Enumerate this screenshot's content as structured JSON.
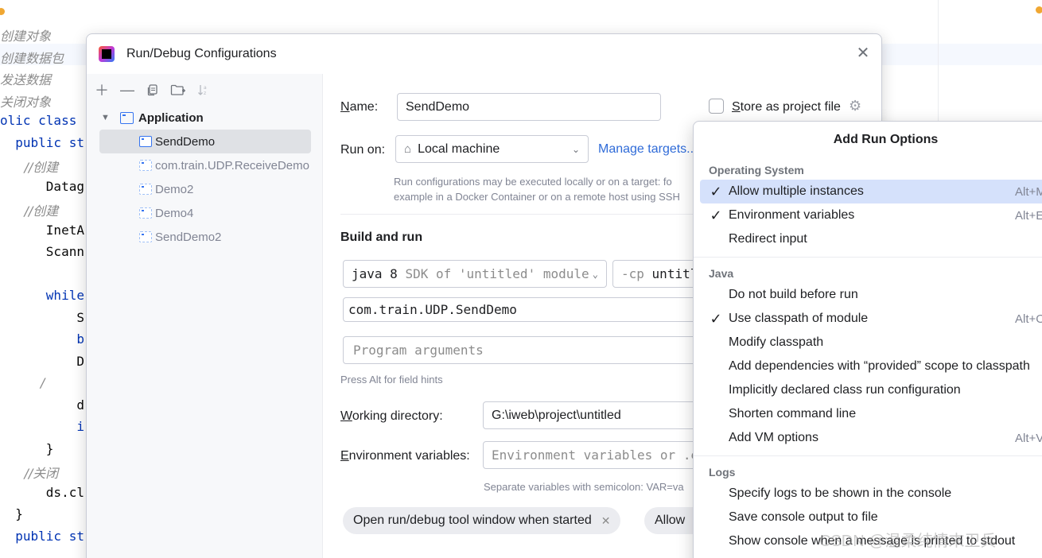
{
  "editor": {
    "lines": [
      {
        "text": "创建对象",
        "kind": "comment"
      },
      {
        "text": "创建数据包",
        "kind": "comment"
      },
      {
        "text": "发送数据",
        "kind": "comment"
      },
      {
        "text": "关闭对象",
        "kind": "comment"
      },
      {
        "text": "olic class",
        "kind": "kw"
      },
      {
        "text": "  public st",
        "kind": "kw"
      },
      {
        "text": "      //创建",
        "kind": "comment"
      },
      {
        "text": "      Datag",
        "kind": "code"
      },
      {
        "text": "      //创建",
        "kind": "comment"
      },
      {
        "text": "      InetA",
        "kind": "code"
      },
      {
        "text": "      Scann",
        "kind": "code"
      },
      {
        "text": "",
        "kind": "code"
      },
      {
        "text": "      while",
        "kind": "kw"
      },
      {
        "text": "          S",
        "kind": "code"
      },
      {
        "text": "          b",
        "kind": "kw"
      },
      {
        "text": "          D",
        "kind": "code"
      },
      {
        "text": "          /",
        "kind": "comment"
      },
      {
        "text": "          d",
        "kind": "code"
      },
      {
        "text": "          i",
        "kind": "kw"
      },
      {
        "text": "      }",
        "kind": "code"
      },
      {
        "text": "      //关闭",
        "kind": "comment"
      },
      {
        "text": "      ds.cl",
        "kind": "code"
      },
      {
        "text": "  }",
        "kind": "code"
      },
      {
        "text": "  public st",
        "kind": "kw"
      }
    ]
  },
  "dialog": {
    "title": "Run/Debug Configurations",
    "close_icon": "close-icon",
    "toolbar": {
      "add_icon": "plus-icon",
      "remove_icon": "minus-icon",
      "copy_icon": "copy-icon",
      "folder_icon": "new-folder-icon",
      "sort_icon": "sort-icon"
    },
    "tree": {
      "group_label": "Application",
      "items": [
        {
          "label": "SendDemo",
          "temporary": false,
          "selected": true
        },
        {
          "label": "com.train.UDP.ReceiveDemo",
          "temporary": true,
          "selected": false
        },
        {
          "label": "Demo2",
          "temporary": true,
          "selected": false
        },
        {
          "label": "Demo4",
          "temporary": true,
          "selected": false
        },
        {
          "label": "SendDemo2",
          "temporary": true,
          "selected": false
        }
      ]
    },
    "form": {
      "name_label_mn": "N",
      "name_label_rest": "ame:",
      "name_value": "SendDemo",
      "store_label_mn": "S",
      "store_label_rest": "tore as project file",
      "run_on_label": "Run on:",
      "run_on_value": "Local machine",
      "manage_targets": "Manage targets...",
      "run_on_hint_1": "Run configurations may be executed locally or on a target: fo",
      "run_on_hint_2": "example in a Docker Container or on a remote host using SSH",
      "build_and_run": "Build and run",
      "sdk_java": "java 8",
      "sdk_rest": "SDK of 'untitled' module",
      "cp_flag": "-cp",
      "cp_value": "untitl",
      "main_class": "com.train.UDP.SendDemo",
      "program_args_placeholder": "Program arguments",
      "alt_hint": "Press Alt for field hints",
      "working_dir_label_mn": "W",
      "working_dir_label_rest": "orking directory:",
      "working_dir_value": "G:\\iweb\\project\\untitled",
      "env_label_mn": "E",
      "env_label_rest": "nvironment variables:",
      "env_placeholder": "Environment variables or .en",
      "env_hint": "Separate variables with semicolon: VAR=va",
      "chip_open_tool_window": "Open run/debug tool window when started",
      "chip_allow": "Allow"
    }
  },
  "popup": {
    "title": "Add Run Options",
    "groups": [
      {
        "title": "Operating System",
        "options": [
          {
            "label": "Allow multiple instances",
            "checked": true,
            "shortcut": "Alt+M",
            "highlighted": true
          },
          {
            "label": "Environment variables",
            "checked": true,
            "shortcut": "Alt+E",
            "highlighted": false
          },
          {
            "label": "Redirect input",
            "checked": false,
            "shortcut": "",
            "highlighted": false
          }
        ]
      },
      {
        "title": "Java",
        "options": [
          {
            "label": "Do not build before run",
            "checked": false,
            "shortcut": "",
            "highlighted": false
          },
          {
            "label": "Use classpath of module",
            "checked": true,
            "shortcut": "Alt+O",
            "highlighted": false
          },
          {
            "label": "Modify classpath",
            "checked": false,
            "shortcut": "",
            "highlighted": false
          },
          {
            "label": "Add dependencies with “provided” scope to classpath",
            "checked": false,
            "shortcut": "",
            "highlighted": false
          },
          {
            "label": "Implicitly declared class run configuration",
            "checked": false,
            "shortcut": "",
            "highlighted": false
          },
          {
            "label": "Shorten command line",
            "checked": false,
            "shortcut": "",
            "highlighted": false
          },
          {
            "label": "Add VM options",
            "checked": false,
            "shortcut": "Alt+V",
            "highlighted": false
          }
        ]
      },
      {
        "title": "Logs",
        "options": [
          {
            "label": "Specify logs to be shown in the console",
            "checked": false,
            "shortcut": "",
            "highlighted": false
          },
          {
            "label": "Save console output to file",
            "checked": false,
            "shortcut": "",
            "highlighted": false
          },
          {
            "label": "Show console when a message is printed to stdout",
            "checked": false,
            "shortcut": "",
            "highlighted": false
          }
        ]
      }
    ]
  },
  "watermark": "CSDN @温柔纯情末卫兵"
}
